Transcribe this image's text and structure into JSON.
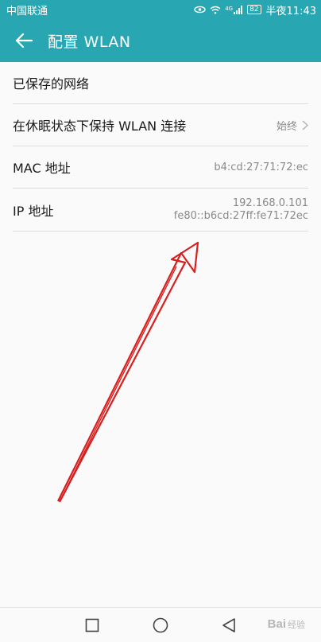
{
  "status_bar": {
    "carrier": "中国联通",
    "network": "4G",
    "battery": "82",
    "time": "半夜11:43"
  },
  "header": {
    "title": "配置 WLAN",
    "back_icon": "back-arrow-icon",
    "background": "#28a7b3"
  },
  "settings": {
    "saved_networks": {
      "label": "已保存的网络"
    },
    "keep_wlan_on_sleep": {
      "label": "在休眠状态下保持 WLAN 连接",
      "value": "始终"
    },
    "mac_address": {
      "label": "MAC 地址",
      "value": "b4:cd:27:71:72:ec"
    },
    "ip_address": {
      "label": "IP 地址",
      "ipv4": "192.168.0.101",
      "ipv6": "fe80::b6cd:27ff:fe71:72ec"
    }
  },
  "nav_bar": {
    "recent_icon": "square-recents-icon",
    "home_icon": "circle-home-icon",
    "back_icon": "triangle-back-icon"
  },
  "watermark": {
    "brand": "Bai",
    "suffix": "经验"
  },
  "annotation": {
    "arrow_color": "#d62020"
  }
}
